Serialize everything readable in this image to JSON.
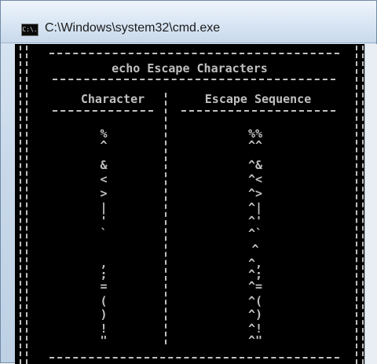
{
  "window": {
    "title": "C:\\Windows\\system32\\cmd.exe",
    "icon": "cmd-icon",
    "icon_text": "C:\\."
  },
  "console": {
    "heading": "echo Escape Characters",
    "columns": [
      "Character",
      "Escape Sequence"
    ],
    "rows": [
      {
        "character": "%",
        "escape": "%%"
      },
      {
        "character": "^",
        "escape": "^^"
      },
      {
        "character": "",
        "escape": ""
      },
      {
        "character": "&",
        "escape": "^&"
      },
      {
        "character": "<",
        "escape": "^<"
      },
      {
        "character": ">",
        "escape": "^>"
      },
      {
        "character": "|",
        "escape": "^|"
      },
      {
        "character": "'",
        "escape": "^'"
      },
      {
        "character": "`",
        "escape": "^`"
      },
      {
        "character": "",
        "escape": "^"
      },
      {
        "character": ",",
        "escape": "^,"
      },
      {
        "character": ";",
        "escape": "^;"
      },
      {
        "character": "=",
        "escape": "^="
      },
      {
        "character": "(",
        "escape": "^("
      },
      {
        "character": ")",
        "escape": "^)"
      },
      {
        "character": "!",
        "escape": "^!"
      },
      {
        "character": "\"",
        "escape": "^\""
      }
    ]
  },
  "colors": {
    "console_bg": "#000000",
    "console_fg": "#c0c0c0",
    "titlebar": "#d9e6f4"
  }
}
